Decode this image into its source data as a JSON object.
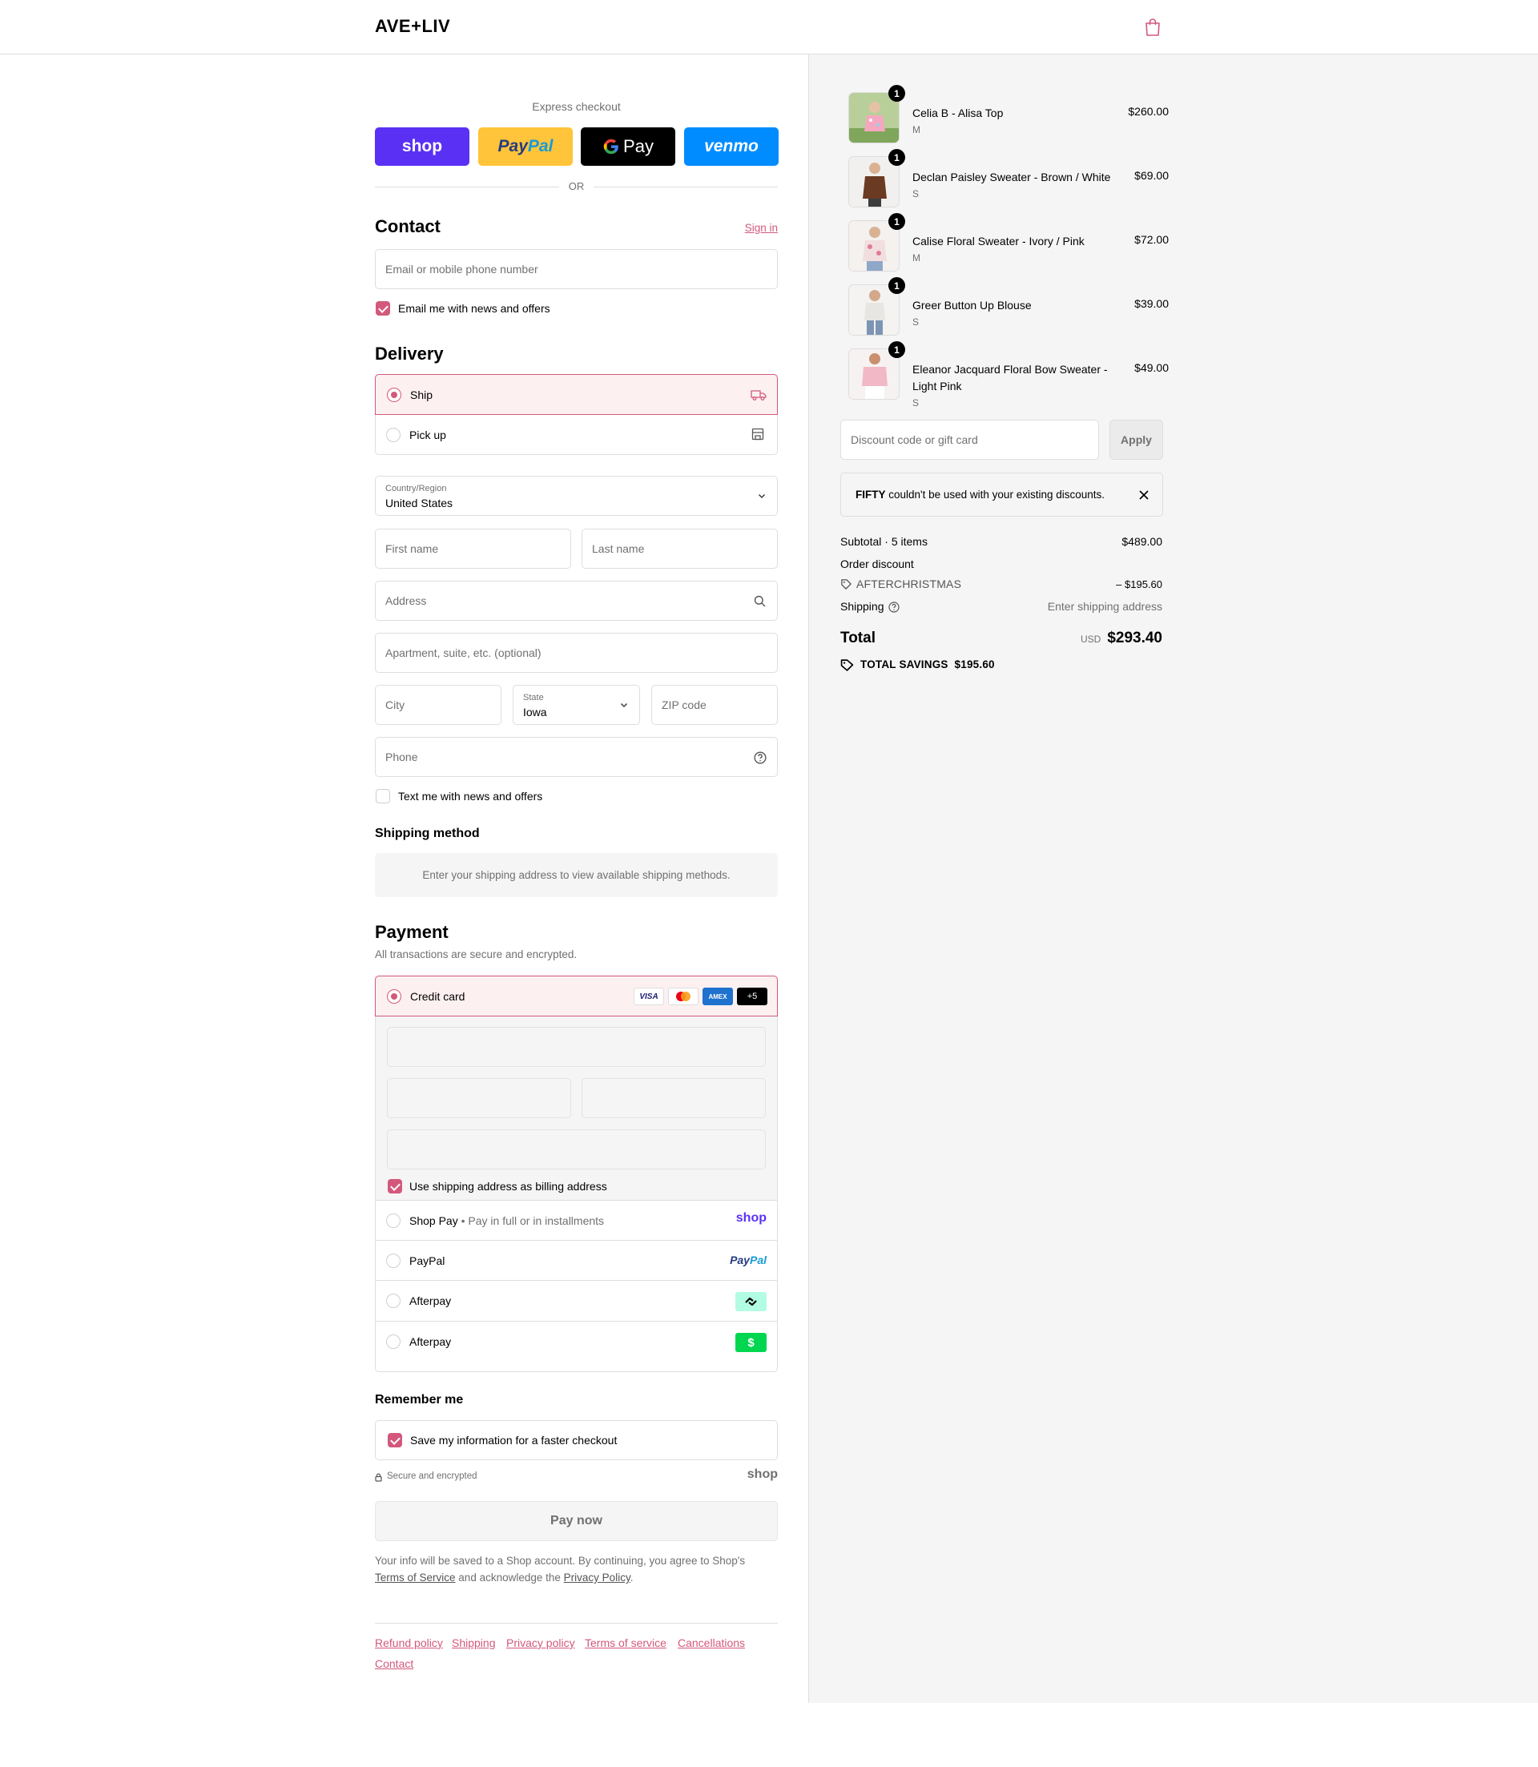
{
  "brand": {
    "name": "AVE+LIV",
    "accent": "#d3587b"
  },
  "express": {
    "title": "Express checkout",
    "shop": "shop",
    "paypal_pay": "Pay",
    "paypal_pal": "Pal",
    "gpay": "Pay",
    "venmo": "venmo",
    "or": "OR"
  },
  "contact": {
    "heading": "Contact",
    "sign_in": "Sign in",
    "email_placeholder": "Email or mobile phone number",
    "news_label": "Email me with news and offers",
    "news_checked": true
  },
  "delivery": {
    "heading": "Delivery",
    "ship": "Ship",
    "pickup": "Pick up",
    "country_label": "Country/Region",
    "country": "United States",
    "first_name": "First name",
    "last_name": "Last name",
    "address": "Address",
    "apartment": "Apartment, suite, etc. (optional)",
    "city": "City",
    "state_label": "State",
    "state": "Iowa",
    "zip": "ZIP code",
    "phone": "Phone",
    "text_label": "Text me with news and offers"
  },
  "shipping_method": {
    "heading": "Shipping method",
    "info": "Enter your shipping address to view available shipping methods."
  },
  "payment": {
    "heading": "Payment",
    "subtitle": "All transactions are secure and encrypted.",
    "credit_card": "Credit card",
    "card_more": "+5",
    "visa": "VISA",
    "amex": "AMEX",
    "billing_label": "Use shipping address as billing address",
    "shop_pay": "Shop Pay",
    "shop_pay_sub": "Pay in full or in installments",
    "shop_logo": "shop",
    "paypal": "PayPal",
    "paypal_logo_pay": "Pay",
    "paypal_logo_pal": "Pal",
    "afterpay": "Afterpay",
    "cashapp": "Afterpay",
    "cashapp_logo": "$"
  },
  "remember": {
    "heading": "Remember me",
    "save_label": "Save my information for a faster checkout",
    "secure": "Secure and encrypted",
    "shop_logo": "shop"
  },
  "pay_now": "Pay now",
  "legal": {
    "text_before": "Your info will be saved to a Shop account. By continuing, you agree to Shop's",
    "terms": "Terms of Service",
    "text_mid": "and acknowledge the",
    "privacy": "Privacy Policy",
    "text_end": "."
  },
  "footer_links": [
    "Refund policy",
    "Shipping",
    "Privacy policy",
    "Terms of service",
    "Cancellations",
    "Contact"
  ],
  "cart": {
    "items": [
      {
        "name": "Celia B - Alisa Top",
        "variant": "M",
        "price": "$260.00",
        "qty": "1",
        "image": "floral-top-photo"
      },
      {
        "name": "Declan Paisley Sweater - Brown / White",
        "variant": "S",
        "price": "$69.00",
        "qty": "1",
        "image": "brown-sweater-photo"
      },
      {
        "name": "Calise Floral Sweater - Ivory / Pink",
        "variant": "M",
        "price": "$72.00",
        "qty": "1",
        "image": "pink-floral-sweater-photo"
      },
      {
        "name": "Greer Button Up Blouse",
        "variant": "S",
        "price": "$39.00",
        "qty": "1",
        "image": "white-blouse-photo"
      },
      {
        "name": "Eleanor Jacquard Floral Bow Sweater - Light Pink",
        "variant": "S",
        "price": "$49.00",
        "qty": "1",
        "image": "light-pink-sweater-photo"
      }
    ],
    "discount_placeholder": "Discount code or gift card",
    "apply": "Apply",
    "alert_code": "FIFTY",
    "alert_text": "couldn't be used with your existing discounts.",
    "subtotal_label": "Subtotal · 5 items",
    "subtotal": "$489.00",
    "order_discount_label": "Order discount",
    "discount_code": "AFTERCHRISTMAS",
    "discount_amount": "– $195.60",
    "shipping_label": "Shipping",
    "shipping_value": "Enter shipping address",
    "total_label": "Total",
    "currency": "USD",
    "total": "$293.40",
    "savings_label": "TOTAL SAVINGS",
    "savings": "$195.60"
  }
}
